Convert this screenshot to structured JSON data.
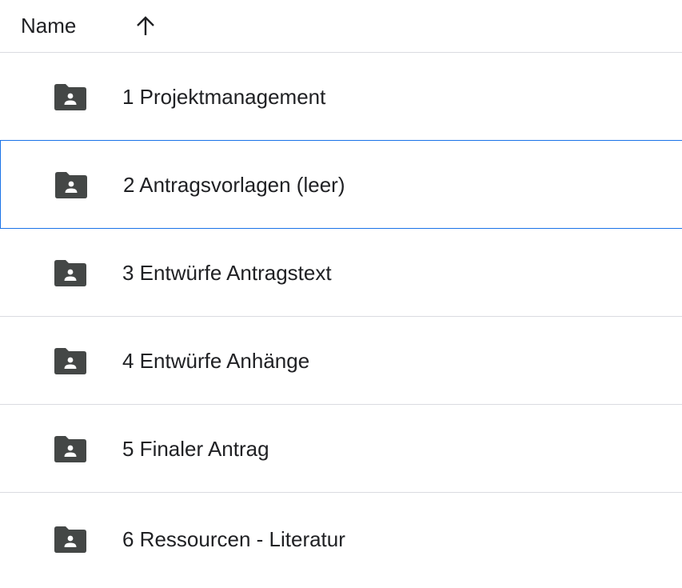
{
  "header": {
    "column_label": "Name",
    "sort_icon": "arrow-up-icon"
  },
  "folders": [
    {
      "label": "1 Projektmanagement",
      "icon": "shared-folder-icon",
      "selected": false
    },
    {
      "label": "2 Antragsvorlagen (leer)",
      "icon": "shared-folder-icon",
      "selected": true
    },
    {
      "label": "3 Entwürfe Antragstext",
      "icon": "shared-folder-icon",
      "selected": false
    },
    {
      "label": "4 Entwürfe Anhänge",
      "icon": "shared-folder-icon",
      "selected": false
    },
    {
      "label": "5 Finaler Antrag",
      "icon": "shared-folder-icon",
      "selected": false
    },
    {
      "label": "6 Ressourcen - Literatur",
      "icon": "shared-folder-icon",
      "selected": false
    }
  ],
  "colors": {
    "selection_border": "#1a73e8",
    "divider": "#dadce0",
    "icon": "#444746",
    "text": "#202124"
  }
}
